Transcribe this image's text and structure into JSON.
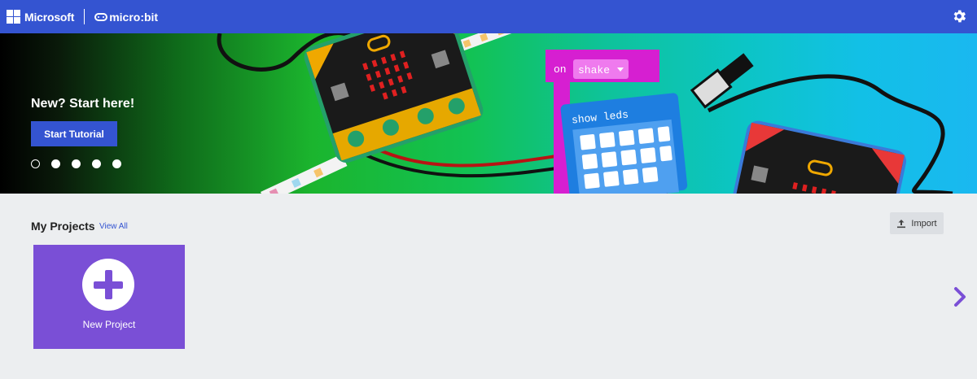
{
  "header": {
    "brand": "Microsoft",
    "product": "micro:bit",
    "icons": {
      "settings": "gear-icon"
    }
  },
  "hero": {
    "title": "New? Start here!",
    "button_label": "Start Tutorial",
    "carousel_dots": 5,
    "active_dot": 1,
    "code_block_event": "on",
    "code_block_dropdown": "shake",
    "code_block_action": "show leds"
  },
  "projects": {
    "heading": "My Projects",
    "view_all": "View All",
    "import_label": "Import",
    "new_project_label": "New Project"
  },
  "colors": {
    "header": "#3454d1",
    "new_project_card": "#7a4fd6",
    "background": "#eceef0"
  }
}
